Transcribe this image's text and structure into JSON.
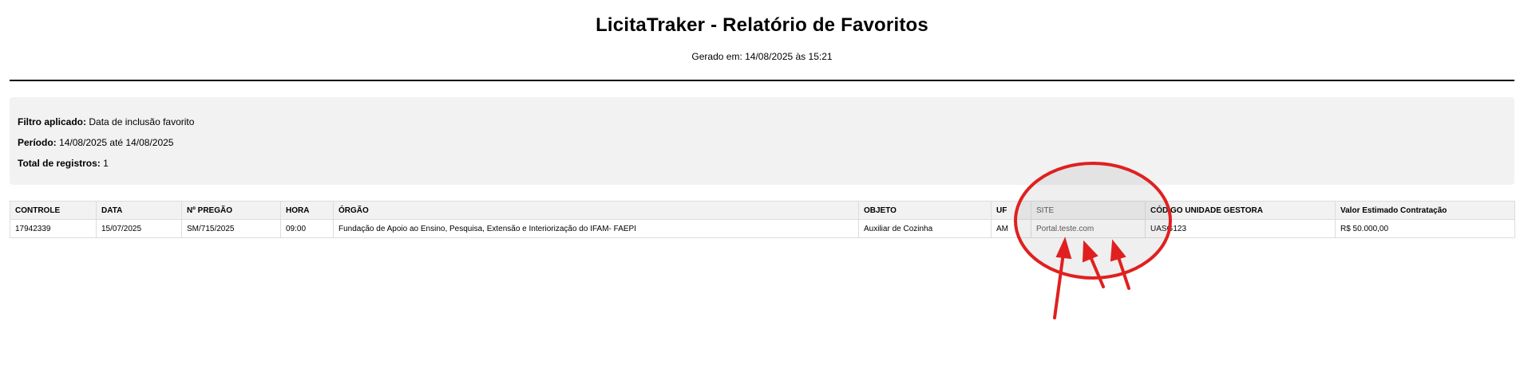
{
  "report": {
    "title": "LicitaTraker - Relatório de Favoritos",
    "generated": "Gerado em: 14/08/2025 às 15:21"
  },
  "filters": {
    "filter_label": "Filtro aplicado:",
    "filter_value": "Data de inclusão favorito",
    "period_label": "Período:",
    "period_value": "14/08/2025 até 14/08/2025",
    "total_label": "Total de registros:",
    "total_value": "1"
  },
  "table": {
    "headers": [
      "CONTROLE",
      "DATA",
      "Nº PREGÃO",
      "HORA",
      "ÓRGÃO",
      "OBJETO",
      "UF",
      "SITE",
      "CÓDIGO UNIDADE GESTORA",
      "Valor Estimado Contratação"
    ],
    "rows": [
      [
        "17942339",
        "15/07/2025",
        "SM/715/2025",
        "09:00",
        "Fundação de Apoio ao Ensino, Pesquisa, Extensão e Interiorização do IFAM- FAEPI",
        "Auxiliar de Cozinha",
        "AM",
        "Portal.teste.com",
        "UASG123",
        "R$ 50.000,00"
      ]
    ]
  },
  "annotation": {
    "color": "#e02020",
    "shape": "ellipse-with-arrows",
    "highlighted_column": "SITE"
  }
}
